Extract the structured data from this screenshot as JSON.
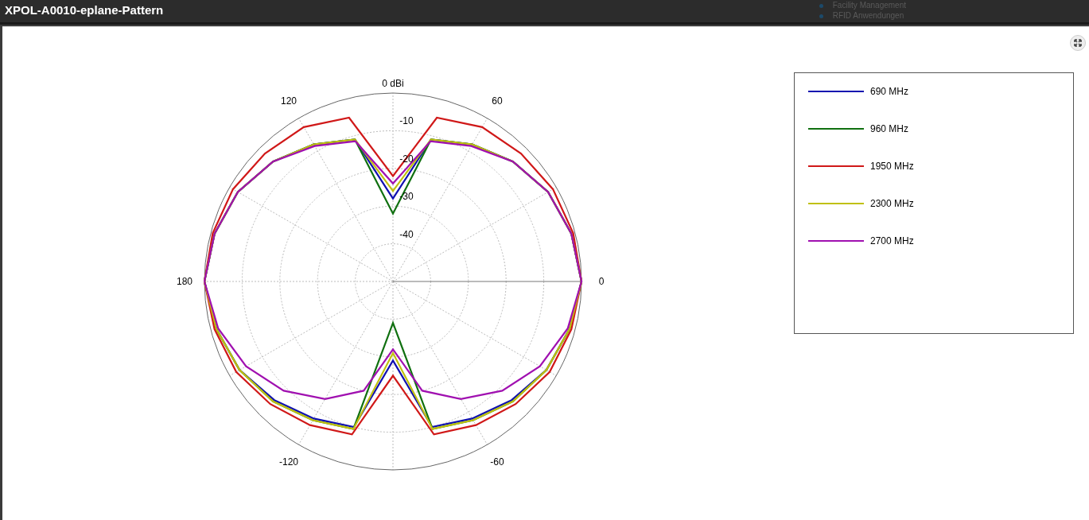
{
  "window": {
    "title": "XPOL-A0010-eplane-Pattern"
  },
  "background_list": [
    "Facility Management",
    "RFID Anwendungen"
  ],
  "plot": {
    "ring_labels": [
      "0 dBi",
      "-10",
      "-20",
      "-30",
      "-40"
    ],
    "angle_labels": [
      "0",
      "60",
      "120",
      "180",
      "-120",
      "-60"
    ],
    "legend": [
      {
        "name": "690 MHz",
        "color": "#1010b0"
      },
      {
        "name": "960 MHz",
        "color": "#107010"
      },
      {
        "name": "1950 MHz",
        "color": "#d01818"
      },
      {
        "name": "2300 MHz",
        "color": "#c0c010"
      },
      {
        "name": "2700 MHz",
        "color": "#a010b0"
      }
    ]
  }
}
